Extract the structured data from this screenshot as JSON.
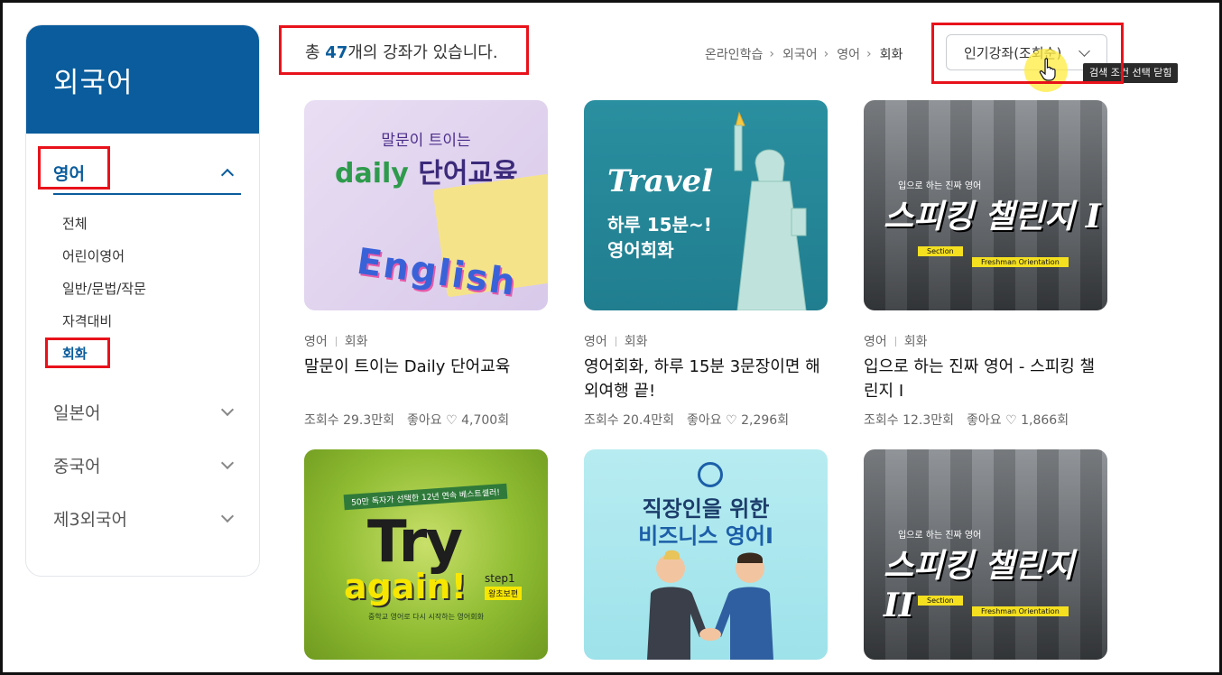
{
  "sidebar": {
    "title": "외국어",
    "active_category": "영어",
    "sub_items": [
      "전체",
      "어린이영어",
      "일반/문법/작문",
      "자격대비",
      "회화"
    ],
    "active_sub": "회화",
    "categories": [
      "일본어",
      "중국어",
      "제3외국어"
    ]
  },
  "header": {
    "count_prefix": "총 ",
    "count": "47",
    "count_suffix": "개의 강좌가 있습니다.",
    "breadcrumb": [
      "온라인학습",
      "외국어",
      "영어",
      "회화"
    ],
    "sort_label": "인기강좌(조회순)",
    "tooltip": "검색 조건 선택 닫힘"
  },
  "courses": [
    {
      "category": "영어",
      "subcategory": "회화",
      "title": "말문이 트이는 Daily 단어교육",
      "views": "조회수 29.3만회",
      "likes": "좋아요 ♡ 4,700회",
      "thumb": {
        "line1": "말문이 트이는",
        "line2a": "daily",
        "line2b": "단어교육",
        "word": "English"
      }
    },
    {
      "category": "영어",
      "subcategory": "회화",
      "title": "영어회화, 하루 15분 3문장이면 해외여행 끝!",
      "views": "조회수 20.4만회",
      "likes": "좋아요 ♡ 2,296회",
      "thumb": {
        "line1": "Travel",
        "line2": "하루 15분~!",
        "line3": "영어회화"
      }
    },
    {
      "category": "영어",
      "subcategory": "회화",
      "title": "입으로 하는 진짜 영어 - 스피킹 챌린지 I",
      "views": "조회수 12.3만회",
      "likes": "좋아요 ♡ 1,866회",
      "thumb": {
        "line1": "입으로 하는 진짜 영어",
        "line2": "스피킹 챌린지",
        "num": "I",
        "tag1": "Section",
        "tag2": "Freshman Orientation"
      }
    },
    {
      "title": "",
      "thumb": {
        "line1": "50만 독자가 선택한 12년 연속 베스트셀러!",
        "line2": "Try",
        "line3": "again!",
        "step": "step1",
        "level": "왕초보편",
        "sub": "중학교 영어로 다시 시작하는 영어회화"
      }
    },
    {
      "title": "",
      "thumb": {
        "line1": "직장인을 위한",
        "line2": "비즈니스 영어I"
      }
    },
    {
      "title": "",
      "thumb": {
        "line1": "입으로 하는 진짜 영어",
        "line2": "스피킹 챌린지",
        "num": "II",
        "tag1": "Section",
        "tag2": "Freshman Orientation"
      }
    }
  ],
  "colors": {
    "brand": "#0a5c9c",
    "highlight": "#e8121b",
    "cursor_glow": "#ffeb3c"
  }
}
